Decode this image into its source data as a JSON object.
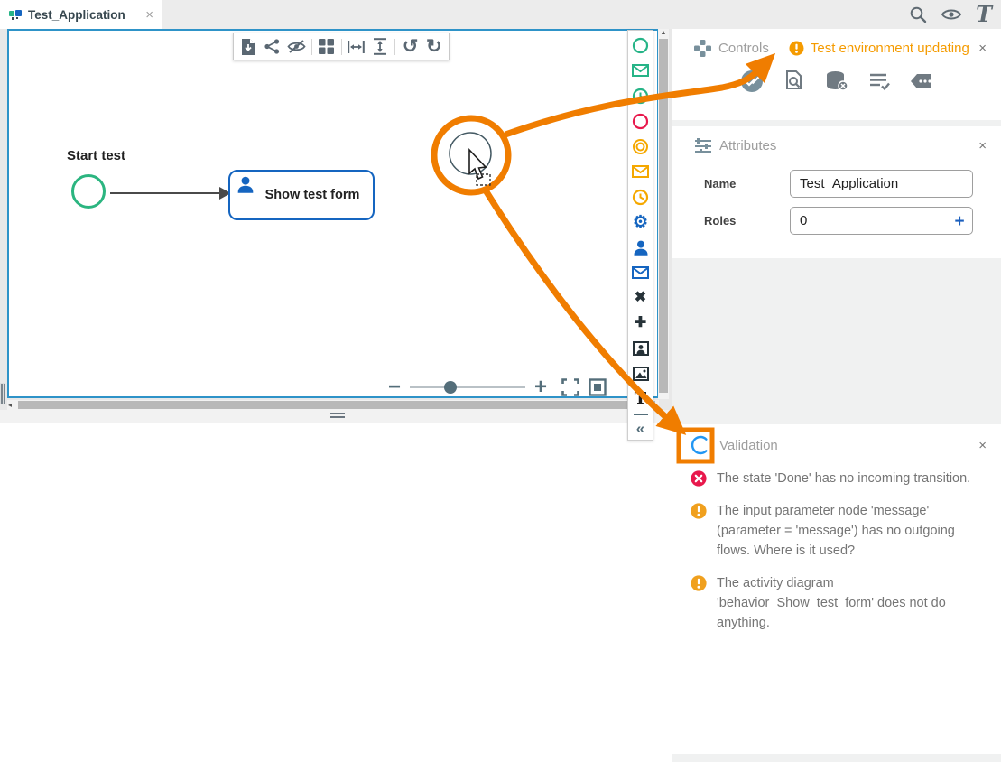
{
  "tab": {
    "title": "Test_Application"
  },
  "topbar": {
    "logo": "T"
  },
  "icons": {
    "close": "×",
    "undo": "↺",
    "redo": "↻",
    "minus": "−",
    "plus": "+",
    "gear": "⚙",
    "heavy_x": "✖",
    "heavy_plus": "✚",
    "text_tool": "T",
    "collapse": "«",
    "scroll_up": "▲",
    "scroll_left": "◂"
  },
  "canvas": {
    "start_label": "Start test",
    "task_label": "Show test form"
  },
  "controls": {
    "title": "Controls",
    "status": "Test environment updating"
  },
  "attributes": {
    "title": "Attributes",
    "name_label": "Name",
    "name_value": "Test_Application",
    "roles_label": "Roles",
    "roles_value": "0"
  },
  "validation": {
    "title": "Validation",
    "messages": [
      {
        "severity": "error",
        "text": "The state 'Done' has no incoming transition."
      },
      {
        "severity": "warning",
        "text": "The input parameter node 'message' (parameter = 'message') has no outgoing flows. Where is it used?"
      },
      {
        "severity": "warning",
        "text": "The activity diagram 'behavior_Show_test_form' does not do anything."
      }
    ]
  },
  "colors": {
    "annotation_orange": "#F07D00",
    "warning_orange": "#F59B00",
    "error_red": "#E8184C",
    "teal": "#26B487",
    "blue": "#1565C0",
    "canvas_border_blue": "#2E93C8"
  }
}
